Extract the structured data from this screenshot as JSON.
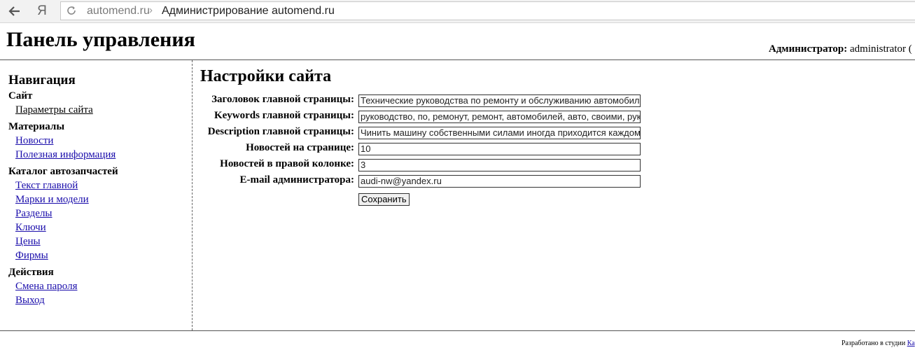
{
  "browser": {
    "back_icon": "arrow-left-icon",
    "yandex_label": "Я",
    "reload_icon": "reload-icon",
    "url_domain": "automend.ru",
    "url_separator": "›",
    "page_title": "Администрирование automend.ru"
  },
  "header": {
    "title": "Панель управления",
    "admin_label": "Администратор:",
    "admin_name": "administrator ("
  },
  "sidebar": {
    "heading": "Навигация",
    "sections": [
      {
        "title": "Сайт",
        "links": [
          "Параметры сайта"
        ]
      },
      {
        "title": "Материалы",
        "links": [
          "Новости",
          "Полезная информация"
        ]
      },
      {
        "title": "Каталог автозапчастей",
        "links": [
          "Текст главной",
          "Марки и модели",
          "Разделы",
          "Ключи",
          "Цены",
          "Фирмы"
        ]
      },
      {
        "title": "Действия",
        "links": [
          "Смена пароля",
          "Выход"
        ]
      }
    ]
  },
  "main": {
    "title": "Настройки сайта",
    "fields": [
      {
        "label": "Заголовок главной страницы:",
        "value": "Технические руководства по ремонту и обслуживанию автомобилей"
      },
      {
        "label": "Keywords главной страницы:",
        "value": "руководство, по, ремонут, ремонт, автомобилей, авто, своими, руками"
      },
      {
        "label": "Description главной страницы:",
        "value": "Чинить машину собственными силами иногда приходится каждому"
      },
      {
        "label": "Новостей на странице:",
        "value": "10"
      },
      {
        "label": "Новостей в правой колонке:",
        "value": "3"
      },
      {
        "label": "E-mail администратора:",
        "value": "audi-nw@yandex.ru"
      }
    ],
    "save_label": "Сохранить"
  },
  "footer": {
    "text": "Разработано в студии ",
    "link": "Ка"
  },
  "colors": {
    "link": "#1a0dab",
    "text": "#000000"
  }
}
